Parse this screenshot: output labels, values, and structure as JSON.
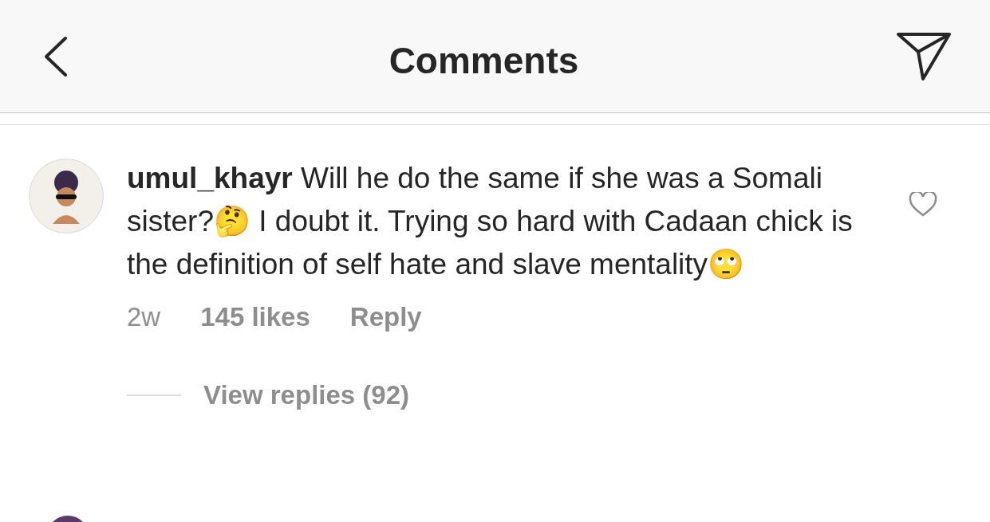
{
  "header": {
    "title": "Comments"
  },
  "comment": {
    "text": "**umul_khayr** Will he do the same if she was a Somali sister?🤔 I doubt it. Trying so hard with Cadaan chick is the definition of self hate and slave mentality🙄",
    "liked": false,
    "age": "2w",
    "likes": "145 likes",
    "reply": "Reply",
    "view_replies": "View replies (92)"
  }
}
